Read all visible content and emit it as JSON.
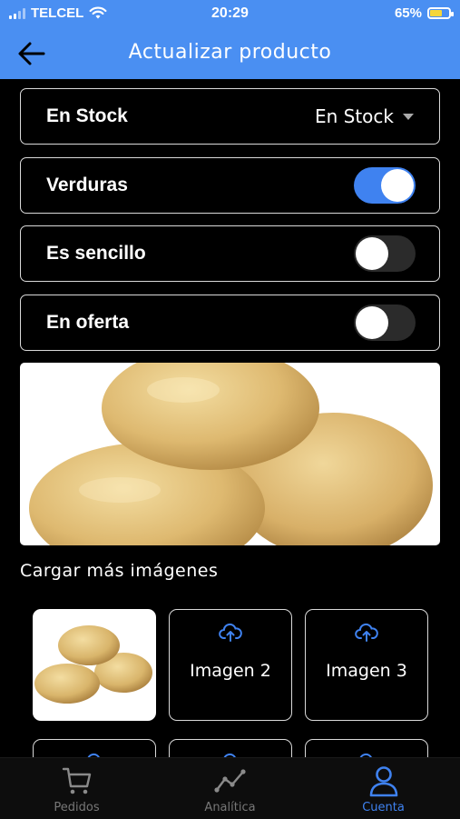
{
  "status_bar": {
    "carrier": "TELCEL",
    "time": "20:29",
    "battery": "65%",
    "battery_level": 0.65
  },
  "app_bar": {
    "back_icon": "arrow-left-icon",
    "title": "Actualizar producto"
  },
  "form": {
    "stock": {
      "label": "En Stock",
      "value": "En Stock"
    },
    "toggles": [
      {
        "label": "Verduras",
        "on": true
      },
      {
        "label": "Es sencillo",
        "on": false
      },
      {
        "label": "En oferta",
        "on": false
      }
    ]
  },
  "images": {
    "section_title": "Cargar más imágenes",
    "slots": [
      {
        "label": "Imagen 2",
        "icon": "cloud-upload-icon"
      },
      {
        "label": "Imagen 3",
        "icon": "cloud-upload-icon"
      }
    ]
  },
  "bottom_nav": {
    "items": [
      {
        "label": "Pedidos",
        "icon": "cart-icon",
        "active": false
      },
      {
        "label": "Analítica",
        "icon": "line-chart-icon",
        "active": false
      },
      {
        "label": "Cuenta",
        "icon": "user-icon",
        "active": true
      }
    ]
  },
  "colors": {
    "primary": "#4a8ff2",
    "toggle_on": "#3f82f0",
    "background": "#000000"
  }
}
